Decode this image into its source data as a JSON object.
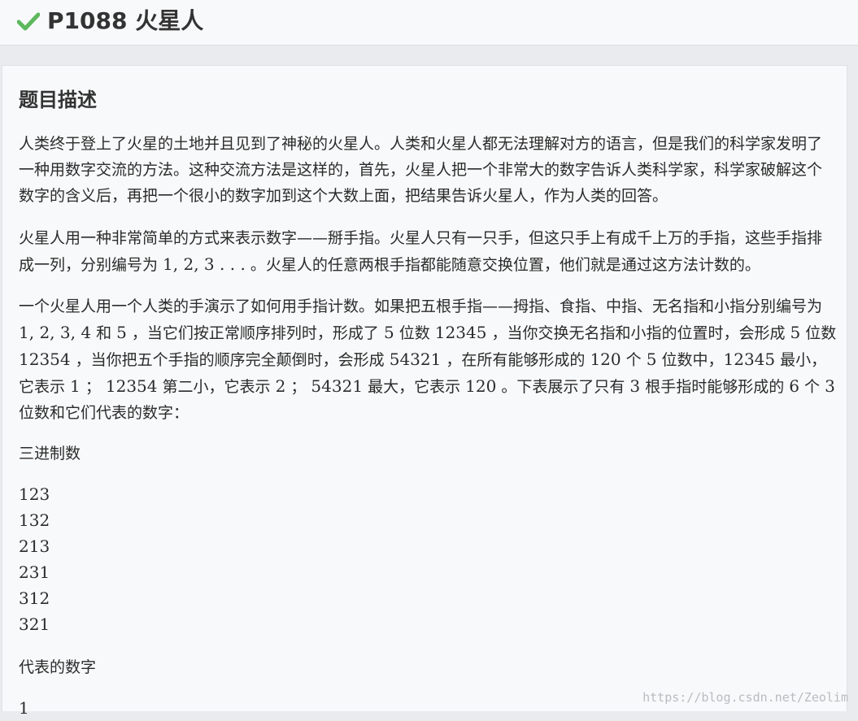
{
  "header": {
    "title": "P1088 火星人",
    "status_icon": "check-icon",
    "status_color": "#5cb85c"
  },
  "description": {
    "heading": "题目描述",
    "p1": "人类终于登上了火星的土地并且见到了神秘的火星人。人类和火星人都无法理解对方的语言，但是我们的科学家发明了一种用数字交流的方法。这种交流方法是这样的，首先，火星人把一个非常大的数字告诉人类科学家，科学家破解这个数字的含义后，再把一个很小的数字加到这个大数上面，把结果告诉火星人，作为人类的回答。",
    "p2": {
      "a": "火星人用一种非常简单的方式来表示数字——掰手指。火星人只有一只手，但这只手上有成千上万的手指，这些手指排成一列，分别编号为 ",
      "m1": "1, 2, 3 . . .",
      "b": " 。火星人的任意两根手指都能随意交换位置，他们就是通过这方法计数的。"
    },
    "p3": {
      "a": "一个火星人用一个人类的手演示了如何用手指计数。如果把五根手指——拇指、食指、中指、无名指和小指分别编号为 ",
      "m1": "1, 2, 3, 4",
      "b": " 和 ",
      "m2": "5",
      "c": " ，当它们按正常顺序排列时，形成了 ",
      "m3": "5",
      "d": " 位数 ",
      "m4": "12345",
      "e": " ，当你交换无名指和小指的位置时，会形成 ",
      "m5": "5",
      "f": " 位数 ",
      "m6": "12354",
      "g": " ，当你把五个手指的顺序完全颠倒时，会形成 ",
      "m7": "54321",
      "h": " ，在所有能够形成的 ",
      "m8": "120",
      "i": " 个 ",
      "m9": "5",
      "j": " 位数中，",
      "m10": "12345",
      "k": " 最小，它表示 ",
      "m11": "1",
      "l": " ； ",
      "m12": "12354",
      "m": " 第二小，它表示 ",
      "m13": "2",
      "n": " ； ",
      "m14": "54321",
      "o": " 最大，它表示 ",
      "m15": "120",
      "p": " 。下表展示了只有 ",
      "m16": "3",
      "q": " 根手指时能够形成的 ",
      "m17": "6",
      "r": " 个 ",
      "m18": "3",
      "s": " 位数和它们代表的数字："
    },
    "table_label_1": "三进制数",
    "ternary": [
      "123",
      "132",
      "213",
      "231",
      "312",
      "321"
    ],
    "table_label_2": "代表的数字",
    "first_value": "1"
  },
  "watermark": "https://blog.csdn.net/Zeolim"
}
